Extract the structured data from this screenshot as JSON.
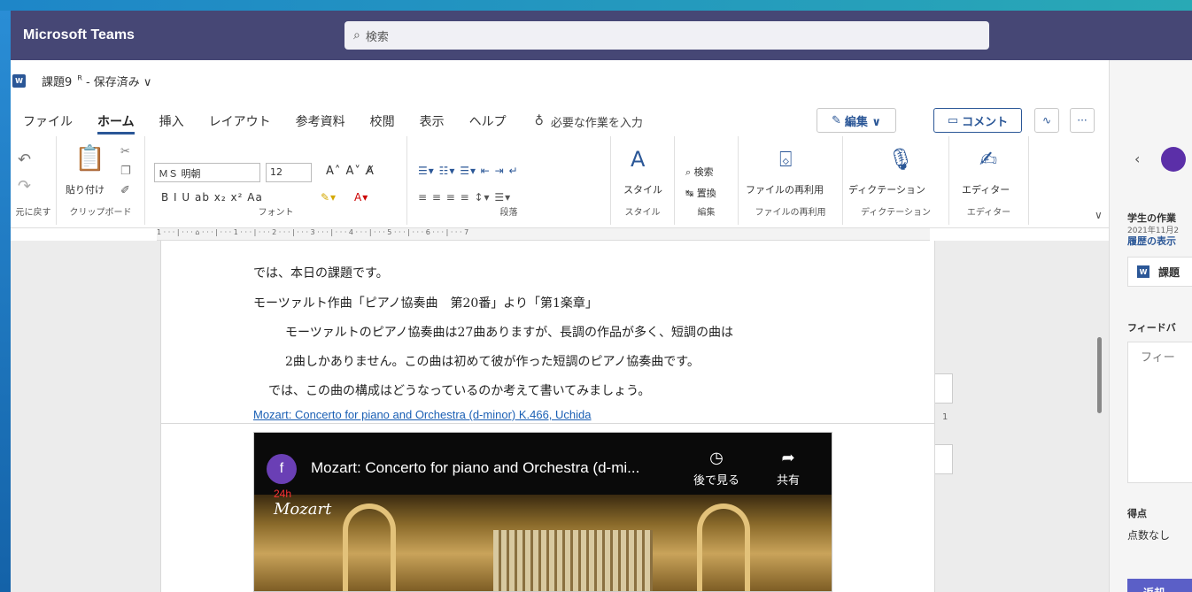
{
  "app": {
    "title": "Microsoft Teams",
    "search_placeholder": "検索"
  },
  "document": {
    "app_badge": "W",
    "name": "課題9",
    "share_glyph": "ᴿ",
    "status": "- 保存済み ∨"
  },
  "ribbon": {
    "tabs": [
      {
        "label": "ファイル"
      },
      {
        "label": "ホーム"
      },
      {
        "label": "挿入"
      },
      {
        "label": "レイアウト"
      },
      {
        "label": "参考資料"
      },
      {
        "label": "校閲"
      },
      {
        "label": "表示"
      },
      {
        "label": "ヘルプ"
      }
    ],
    "tell_me": "必要な作業を入力",
    "edit_label": "編集 ∨",
    "comment_label": "コメント",
    "more_label": "···",
    "groups": {
      "undo": "元に戻す",
      "clipboard": "クリップボード",
      "paste": "貼り付け",
      "font": "フォント",
      "paragraph": "段落",
      "styles": "スタイル",
      "styles_group": "スタイル",
      "editing": "編集",
      "search": "検索",
      "replace": "置換",
      "reuse": "ファイルの再利用",
      "reuse_group": "ファイルの再利用",
      "dictation": "ディクテーション",
      "dictation_group": "ディクテーション",
      "editor": "エディター",
      "editor_group": "エディター"
    },
    "font_name": "ＭＳ 明朝",
    "font_size": "12",
    "format_row": "B  I  U  ab  x₂  x²  Aa",
    "ruler_text": "1 · · · | · · · ⌂ · · · | · · · 1 · · · | · · · 2 · · · | · · · 3 · · · | · · · 4 · · · | · · · 5 · · · | · · · 6 · · · | · · · 7"
  },
  "body": {
    "line1": "では、本日の課題です。",
    "line2": "モーツァルト作曲「ピアノ協奏曲　第20番」より「第1楽章」",
    "line3": "モーツァルトのピアノ協奏曲は27曲ありますが、長調の作品が多く、短調の曲は",
    "line4": "2曲しかありません。この曲は初めて彼が作った短調のピアノ協奏曲です。",
    "line5": "では、この曲の構成はどうなっているのか考えて書いてみましょう。",
    "link": "Mozart: Concerto for piano and Orchestra (d-minor) K.466, Uchida",
    "page_number": "1"
  },
  "video": {
    "avatar_letter": "f",
    "title": "Mozart: Concerto for piano and Orchestra (d-mi...",
    "watch_later": "後で見る",
    "share": "共有",
    "brand_small": "24h",
    "brand_script": "Mozart"
  },
  "panel": {
    "student_work": "学生の作業",
    "date": "2021年11月2",
    "history": "履歴の表示",
    "file_name": "課題",
    "feedback_label": "フィードバ",
    "feedback_placeholder": "フィー",
    "score_label": "得点",
    "score_value": "点数なし",
    "return_button": "返却"
  }
}
